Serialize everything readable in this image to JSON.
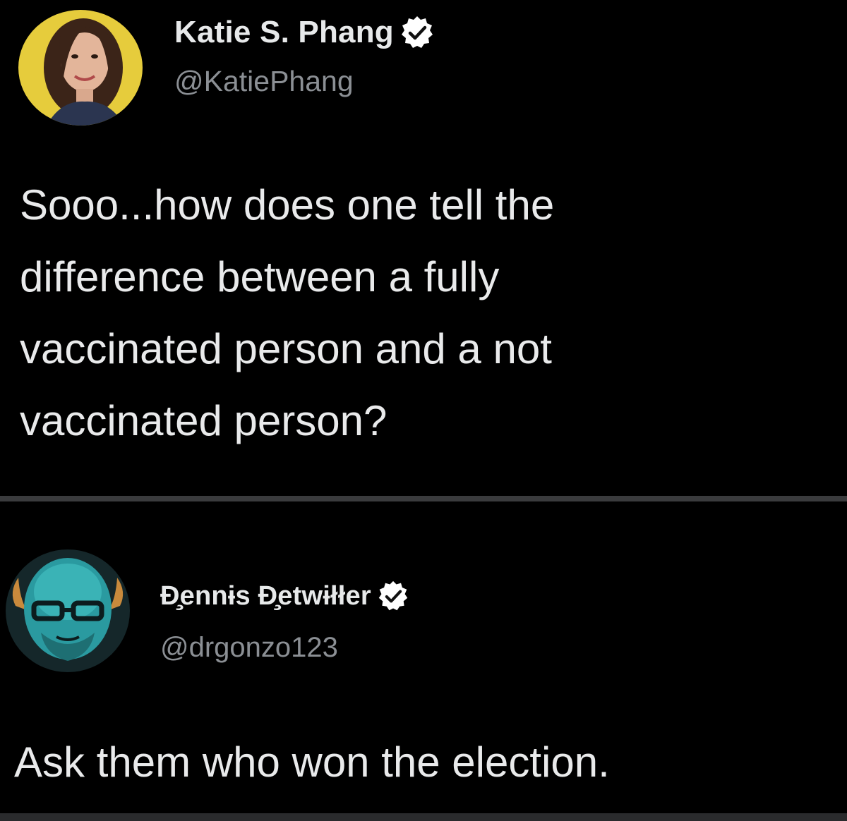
{
  "tweets": [
    {
      "display_name": "Katie S. Phang",
      "handle": "@KatiePhang",
      "text": "Sooo...how does one tell the\ndifference between a fully\nvaccinated person and a not\nvaccinated person?",
      "avatar_icon": "profile-photo-woman",
      "verified_icon": "verified-check-icon"
    },
    {
      "display_name": "Đ̧ennɨs Đ̧etwɨłłer",
      "handle": "@drgonzo123",
      "text": "Ask them who won the election.",
      "avatar_icon": "profile-illustration-bald-man-glasses",
      "verified_icon": "verified-check-icon"
    }
  ],
  "colors": {
    "background": "#000000",
    "text": "#e7e9ea",
    "handle": "#8b8f94",
    "separator": "#3a3b3d",
    "avatar1_bg": "#e6cc3c",
    "avatar2_bg": "#2a9aa0"
  }
}
